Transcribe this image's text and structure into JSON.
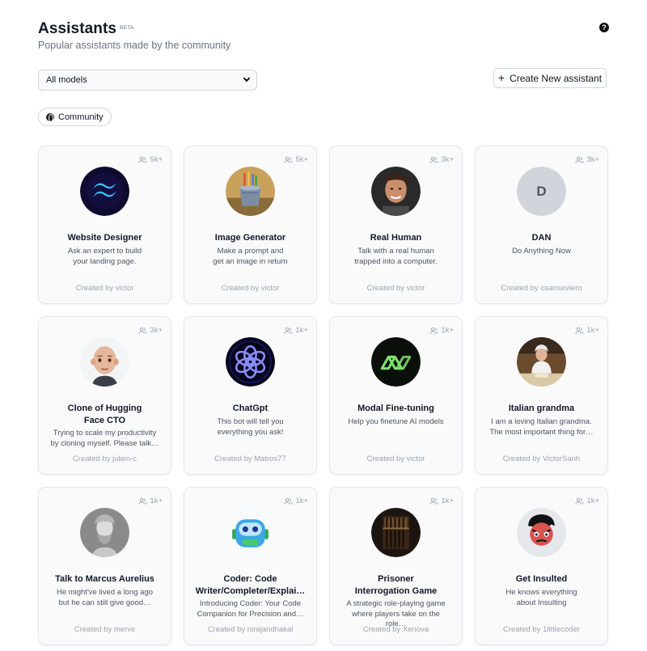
{
  "header": {
    "title": "Assistants",
    "badge": "BETA",
    "subtitle": "Popular assistants made by the community",
    "help_icon": "question-circle-icon"
  },
  "filters": {
    "model_select_value": "All models",
    "create_button_label": "Create New assistant",
    "community_pill_label": "Community"
  },
  "assistants": [
    {
      "name_line1": "Website Designer",
      "name_line2": "",
      "desc_line1": "Ask an expert to build",
      "desc_line2": "your landing page.",
      "created_by": "Created by victor",
      "count": "5k+",
      "avatar": "tailwind-logo"
    },
    {
      "name_line1": "Image Generator",
      "name_line2": "",
      "desc_line1": "Make a prompt and",
      "desc_line2": "get an image in return",
      "created_by": "Created by victor",
      "count": "5k+",
      "avatar": "paint-bucket"
    },
    {
      "name_line1": "Real Human",
      "name_line2": "",
      "desc_line1": "Talk with a real human",
      "desc_line2": "trapped into a computer.",
      "created_by": "Created by victor",
      "count": "3k+",
      "avatar": "human-face"
    },
    {
      "name_line1": "DAN",
      "name_line2": "",
      "desc_line1": "Do Anything Now",
      "desc_line2": "",
      "created_by": "Created by osanseviero",
      "count": "3k+",
      "avatar": "letter-d",
      "avatar_letter": "D"
    },
    {
      "name_line1": "Clone of Hugging",
      "name_line2": "Face CTO",
      "desc_line1": "Trying to scale my productivity",
      "desc_line2": "by cloning myself. Please talk…",
      "created_by": "Created by julien-c",
      "count": "3k+",
      "avatar": "memoji-bald"
    },
    {
      "name_line1": "ChatGpt",
      "name_line2": "",
      "desc_line1": "This bot will tell you",
      "desc_line2": "everything you ask!",
      "created_by": "Created by Matros77",
      "count": "1k+",
      "avatar": "neon-knot"
    },
    {
      "name_line1": "Modal Fine-tuning",
      "name_line2": "",
      "desc_line1": "Help you finetune AI models",
      "desc_line2": "",
      "created_by": "Created by victor",
      "count": "1k+",
      "avatar": "modal-logo"
    },
    {
      "name_line1": "Italian grandma",
      "name_line2": "",
      "desc_line1": "I am a loving Italian grandma.",
      "desc_line2": "The most important thing for…",
      "created_by": "Created by VictorSanh",
      "count": "1k+",
      "avatar": "grandma-photo"
    },
    {
      "name_line1": "Talk to Marcus Aurelius",
      "name_line2": "",
      "desc_line1": "He might've lived a long ago",
      "desc_line2": "but he can still give good…",
      "created_by": "Created by merve",
      "count": "1k+",
      "avatar": "marble-bust"
    },
    {
      "name_line1": "Coder: Code",
      "name_line2": "Writer/Completer/Explai…",
      "desc_line1": "Introducing Coder: Your Code",
      "desc_line2": "Companion for Precision and…",
      "created_by": "Created by nirajandhakal",
      "count": "1k+",
      "avatar": "robot-head"
    },
    {
      "name_line1": "Prisoner",
      "name_line2": "Interrogation Game",
      "desc_line1": "A strategic role-playing game",
      "desc_line2": "where players take on the role…",
      "created_by": "Created by Xenova",
      "count": "1k+",
      "avatar": "prison-cell"
    },
    {
      "name_line1": "Get Insulted",
      "name_line2": "",
      "desc_line1": "He knows everything",
      "desc_line2": "about Insulting",
      "created_by": "Created by 1littlecoder",
      "count": "1k+",
      "avatar": "angry-cartoon"
    }
  ]
}
